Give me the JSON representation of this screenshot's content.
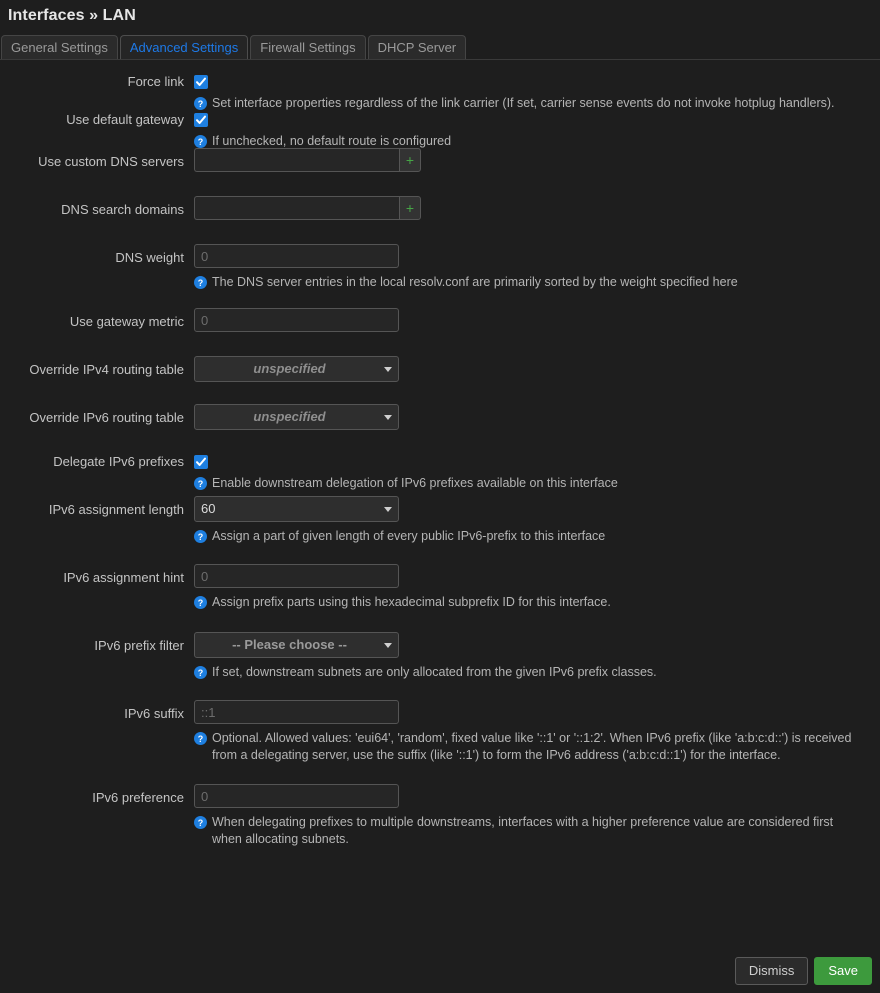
{
  "header": {
    "title": "Interfaces » LAN"
  },
  "tabs": [
    {
      "label": "General Settings",
      "active": false
    },
    {
      "label": "Advanced Settings",
      "active": true
    },
    {
      "label": "Firewall Settings",
      "active": false
    },
    {
      "label": "DHCP Server",
      "active": false
    }
  ],
  "fields": {
    "force_link": {
      "label": "Force link",
      "checked": true,
      "help": "Set interface properties regardless of the link carrier (If set, carrier sense events do not invoke hotplug handlers)."
    },
    "use_default_gateway": {
      "label": "Use default gateway",
      "checked": true,
      "help": "If unchecked, no default route is configured"
    },
    "custom_dns_servers": {
      "label": "Use custom DNS servers",
      "value": "",
      "placeholder": "",
      "add_label": "+"
    },
    "dns_search_domains": {
      "label": "DNS search domains",
      "value": "",
      "placeholder": "",
      "add_label": "+"
    },
    "dns_weight": {
      "label": "DNS weight",
      "value": "",
      "placeholder": "0",
      "help": "The DNS server entries in the local resolv.conf are primarily sorted by the weight specified here"
    },
    "gateway_metric": {
      "label": "Use gateway metric",
      "value": "",
      "placeholder": "0"
    },
    "override_ipv4_table": {
      "label": "Override IPv4 routing table",
      "selected": "unspecified"
    },
    "override_ipv6_table": {
      "label": "Override IPv6 routing table",
      "selected": "unspecified"
    },
    "delegate_ipv6_prefixes": {
      "label": "Delegate IPv6 prefixes",
      "checked": true,
      "help": "Enable downstream delegation of IPv6 prefixes available on this interface"
    },
    "ipv6_assignment_length": {
      "label": "IPv6 assignment length",
      "selected": "60",
      "help": "Assign a part of given length of every public IPv6-prefix to this interface"
    },
    "ipv6_assignment_hint": {
      "label": "IPv6 assignment hint",
      "value": "",
      "placeholder": "0",
      "help": "Assign prefix parts using this hexadecimal subprefix ID for this interface."
    },
    "ipv6_prefix_filter": {
      "label": "IPv6 prefix filter",
      "selected": "-- Please choose --",
      "help": "If set, downstream subnets are only allocated from the given IPv6 prefix classes."
    },
    "ipv6_suffix": {
      "label": "IPv6 suffix",
      "value": "",
      "placeholder": "::1",
      "help": "Optional. Allowed values: 'eui64', 'random', fixed value like '::1' or '::1:2'. When IPv6 prefix (like 'a:b:c:d::') is received from a delegating server, use the suffix (like '::1') to form the IPv6 address ('a:b:c:d::1') for the interface."
    },
    "ipv6_preference": {
      "label": "IPv6 preference",
      "value": "",
      "placeholder": "0",
      "help": "When delegating prefixes to multiple downstreams, interfaces with a higher preference value are considered first when allocating subnets."
    }
  },
  "footer": {
    "dismiss_label": "Dismiss",
    "save_label": "Save"
  },
  "colors": {
    "accent_blue": "#1e7fe0",
    "active_tab_text": "#1e79e6",
    "save_green": "#3d9a3d",
    "add_green": "#46a546",
    "background": "#1e1e1e"
  }
}
